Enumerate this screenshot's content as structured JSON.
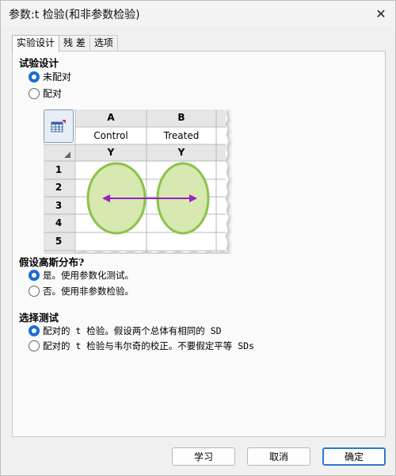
{
  "window": {
    "title": "参数:t 检验(和非参数检验)"
  },
  "tabs": [
    {
      "label": "实验设计",
      "active": true
    },
    {
      "label": "残 差",
      "active": false
    },
    {
      "label": "选项",
      "active": false
    }
  ],
  "experiment_design": {
    "title": "试验设计",
    "options": [
      {
        "label": "未配对",
        "checked": true
      },
      {
        "label": "配对",
        "checked": false
      }
    ]
  },
  "illustration": {
    "col_headers": [
      "A",
      "B"
    ],
    "group_names": [
      "Control",
      "Treated"
    ],
    "sub_headers": [
      "Y",
      "Y"
    ],
    "rows": [
      "1",
      "2",
      "3",
      "4",
      "5"
    ]
  },
  "gaussian": {
    "title": "假设高斯分布?",
    "options": [
      {
        "label": "是。使用参数化测试。",
        "checked": true
      },
      {
        "label": "否。使用非参数检验。",
        "checked": false
      }
    ]
  },
  "choose_test": {
    "title": "选择测试",
    "options": [
      {
        "label": "配对的 t 检验。假设两个总体有相同的 SD",
        "checked": true
      },
      {
        "label": "配对的 t 检验与韦尔奇的校正。不要假定平等 SDs",
        "checked": false
      }
    ]
  },
  "buttons": {
    "learn": "学习",
    "cancel": "取消",
    "ok": "确定"
  },
  "colors": {
    "accent": "#1a6dd4",
    "oval_fill": "#d7e8b0",
    "oval_stroke": "#8cc24a",
    "arrow": "#9a1fc7"
  }
}
